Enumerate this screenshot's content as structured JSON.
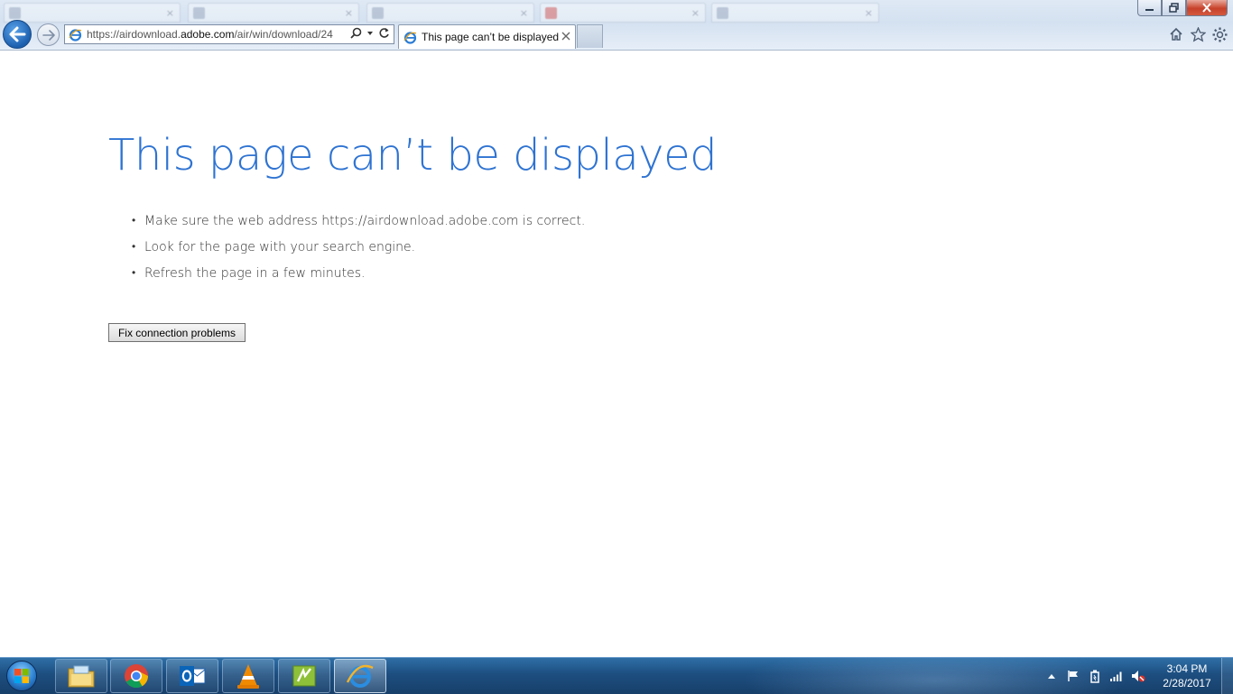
{
  "browser": {
    "address_url_prefix": "https://airdownload.",
    "address_url_domain": "adobe.com",
    "address_url_suffix": "/air/win/download/24",
    "active_tab_title": "This page can’t be displayed",
    "icons": {
      "back": "back-arrow-icon",
      "forward": "forward-arrow-icon",
      "search": "search-icon",
      "dropdown": "dropdown-icon",
      "refresh": "refresh-icon",
      "tab_close": "close-icon",
      "home": "home-icon",
      "favorites": "star-icon",
      "tools": "gear-icon"
    }
  },
  "page": {
    "title": "This page can’t be displayed",
    "tips": [
      "Make sure the web address https://airdownload.adobe.com is correct.",
      "Look for the page with your search engine.",
      "Refresh the page in a few minutes."
    ],
    "fix_button_label": "Fix connection problems"
  },
  "taskbar": {
    "items": [
      "file-explorer",
      "chrome",
      "outlook",
      "vlc",
      "app-green",
      "internet-explorer"
    ],
    "clock_time": "3:04 PM",
    "clock_date": "2/28/2017"
  },
  "colors": {
    "title_blue": "#2e73d2",
    "taskbar": "#1d4e80"
  }
}
